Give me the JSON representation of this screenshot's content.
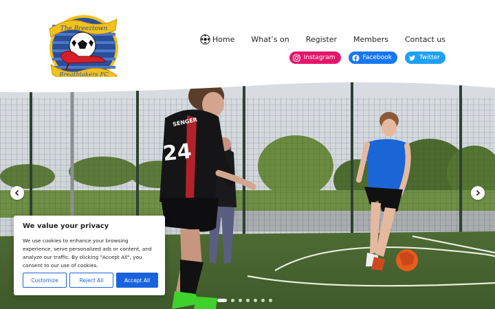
{
  "logo": {
    "line1": "The Breeztown",
    "line2": "Breathtakers FC",
    "colors": {
      "blue": "#2a4f9a",
      "yellow": "#f2c21b",
      "red": "#d41f2a"
    }
  },
  "nav": {
    "items": [
      {
        "label": "Home",
        "icon": "football-icon"
      },
      {
        "label": "What’s on"
      },
      {
        "label": "Register"
      },
      {
        "label": "Members"
      },
      {
        "label": "Contact us"
      }
    ]
  },
  "social": {
    "instagram": {
      "label": "Instagram",
      "icon": "instagram-icon",
      "color": "#e4166b"
    },
    "facebook": {
      "label": "Facebook",
      "icon": "facebook-icon",
      "color": "#1877f2"
    },
    "twitter": {
      "label": "Twitter",
      "icon": "twitter-icon",
      "color": "#1da1f2"
    }
  },
  "hero": {
    "shirt_number": "24",
    "shirt_name": "SENGER",
    "slides_total": 7,
    "active_slide": 1
  },
  "cookie": {
    "title": "We value your privacy",
    "body": "We use cookies to enhance your browsing experience, serve personalized ads or content, and analyze our traffic. By clicking \"Accept All\", you consent to our use of cookies.",
    "customize": "Customize",
    "reject": "Reject All",
    "accept": "Accept All",
    "accent": "#1863dc"
  }
}
